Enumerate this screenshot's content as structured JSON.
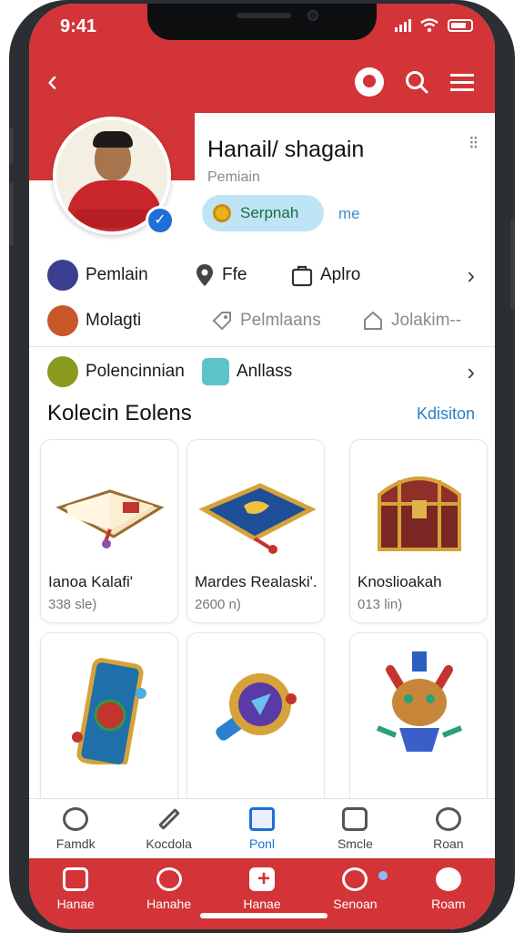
{
  "status_bar": {
    "time": "9:41"
  },
  "profile": {
    "name": "Hanail/ shagain",
    "subtitle": "Pemiain",
    "badge_label": "Serpnah",
    "badge_link": "me"
  },
  "info_rows": [
    {
      "items": [
        "Pemlain",
        "Ffe",
        "Aplro"
      ]
    },
    {
      "items": [
        "Molagti",
        "Pelmlaans",
        "Jolakim--"
      ]
    },
    {
      "items": [
        "Polencinnian",
        "Anllass"
      ]
    }
  ],
  "collection": {
    "title": "Kolecin Eolens",
    "link": "Kdisiton",
    "cards": [
      {
        "title": "Ianoa Kalafi'",
        "meta": "338 sle)"
      },
      {
        "title": "Mardes Realaski'.",
        "meta": "2600 n)"
      },
      {
        "title": "Knoslioakah",
        "meta": "013 lin)"
      },
      {
        "title": "",
        "meta": ""
      },
      {
        "title": "",
        "meta": ""
      },
      {
        "title": "",
        "meta": ""
      }
    ]
  },
  "nav": {
    "items": [
      "Famdk",
      "Kocdola",
      "Ponl",
      "Smcle",
      "Roan"
    ],
    "active": "Ponl"
  },
  "tabs": {
    "items": [
      "Hanae",
      "Hanahe",
      "Hanae",
      "Senoan",
      "Roam"
    ]
  },
  "colors": {
    "brand_red": "#d23438",
    "accent_blue": "#1e6fd6",
    "badge_bg": "#bfe4f6"
  }
}
